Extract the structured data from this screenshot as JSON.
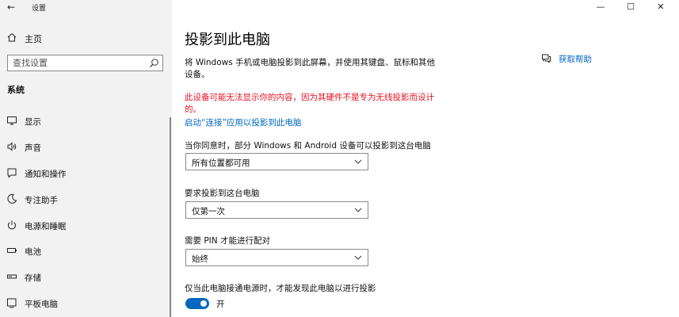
{
  "app": {
    "title": "设置",
    "back_glyph": "←",
    "window_controls": {
      "minimize": "—",
      "maximize": "☐",
      "close": "✕"
    }
  },
  "sidebar": {
    "home_label": "主页",
    "search": {
      "placeholder": "查找设置",
      "value": ""
    },
    "section_title": "系统",
    "items": [
      {
        "label": "显示",
        "icon": "monitor-icon"
      },
      {
        "label": "声音",
        "icon": "speaker-icon"
      },
      {
        "label": "通知和操作",
        "icon": "notification-icon"
      },
      {
        "label": "专注助手",
        "icon": "moon-icon"
      },
      {
        "label": "电源和睡眠",
        "icon": "power-icon"
      },
      {
        "label": "电池",
        "icon": "battery-icon"
      },
      {
        "label": "存储",
        "icon": "storage-icon"
      },
      {
        "label": "平板电脑",
        "icon": "tablet-icon"
      }
    ]
  },
  "main": {
    "title": "投影到此电脑",
    "description": "将 Windows 手机或电脑投影到此屏幕，并使用其键盘、鼠标和其他设备。",
    "warning": "此设备可能无法显示你的内容，因为其硬件不是专为无线投影而设计的。",
    "link": "启动“连接”应用以投影到此电脑",
    "help_label": "获取帮助",
    "settings": [
      {
        "label": "当你同意时，部分 Windows 和 Android 设备可以投影到这台电脑",
        "value": "所有位置都可用"
      },
      {
        "label": "要求投影到这台电脑",
        "value": "仅第一次"
      },
      {
        "label": "需要 PIN 才能进行配对",
        "value": "始终"
      }
    ],
    "power_setting": {
      "label": "仅当此电脑接通电源时，才能发现此电脑以进行投影",
      "toggle_state": "开",
      "enabled": true
    }
  },
  "colors": {
    "accent": "#0067c0",
    "warning": "#e81123",
    "sidebar_bg": "#f2f2f2"
  }
}
